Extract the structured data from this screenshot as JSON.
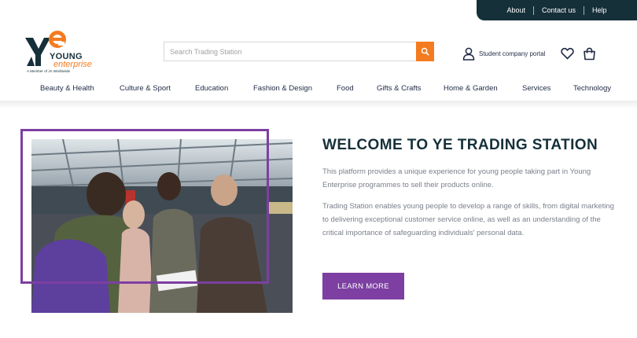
{
  "utility_nav": {
    "about": "About",
    "contact": "Contact us",
    "help": "Help"
  },
  "logo": {
    "line1": "YOUNG",
    "line2": "enterprise",
    "tagline": "A Member of JA Worldwide"
  },
  "search": {
    "placeholder": "Search Trading Station",
    "icon": "search-icon"
  },
  "header_actions": {
    "portal_label": "Student company portal",
    "portal_icon": "user-icon",
    "wishlist_icon": "heart-icon",
    "basket_icon": "shopping-bag-icon"
  },
  "categories": [
    "Beauty & Health",
    "Culture & Sport",
    "Education",
    "Fashion & Design",
    "Food",
    "Gifts & Crafts",
    "Home & Garden",
    "Services",
    "Technology"
  ],
  "hero": {
    "title": "WELCOME TO YE TRADING STATION",
    "paragraph1": "This platform provides a unique experience for young people taking part in Young Enterprise programmes to sell their products online.",
    "paragraph2": "Trading Station enables young people to develop a range of skills, from digital marketing to delivering exceptional customer service online, as well as an understanding of the critical importance of safeguarding individuals' personal data.",
    "cta_label": "LEARN MORE"
  },
  "colors": {
    "utility_bar": "#16303a",
    "accent_orange": "#f47b20",
    "accent_purple": "#7d3fa2",
    "heading": "#16303a",
    "body_text": "#7a7f8a"
  }
}
